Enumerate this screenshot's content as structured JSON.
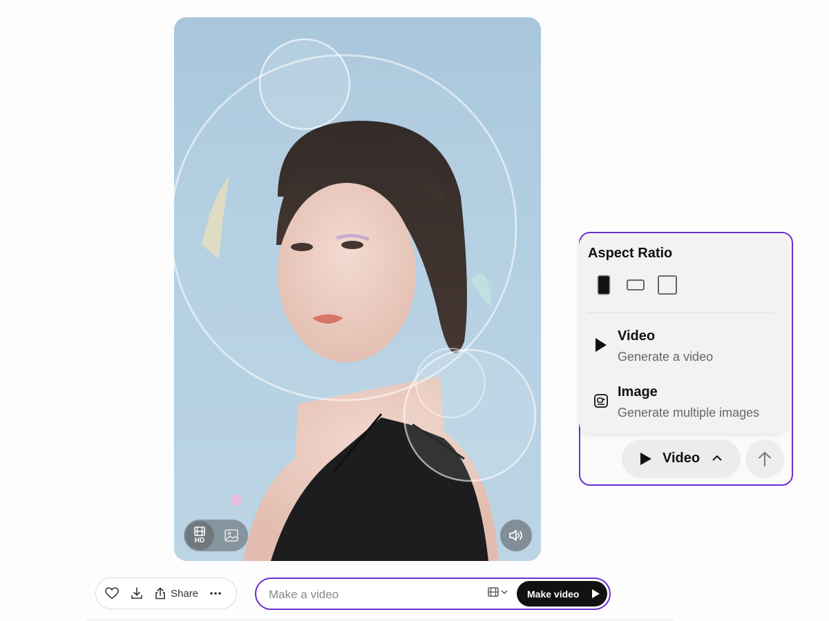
{
  "media": {
    "hd_label": "HD"
  },
  "actions": {
    "share_label": "Share"
  },
  "prompt": {
    "placeholder": "Make a video",
    "button_label": "Make video"
  },
  "menu": {
    "title": "Aspect Ratio",
    "options": [
      {
        "title": "Video",
        "subtitle": "Generate a video"
      },
      {
        "title": "Image",
        "subtitle": "Generate multiple images"
      }
    ]
  },
  "mode_button": {
    "label": "Video"
  },
  "colors": {
    "accent_outline": "#6a2fd0",
    "primary_button": "#111111"
  }
}
